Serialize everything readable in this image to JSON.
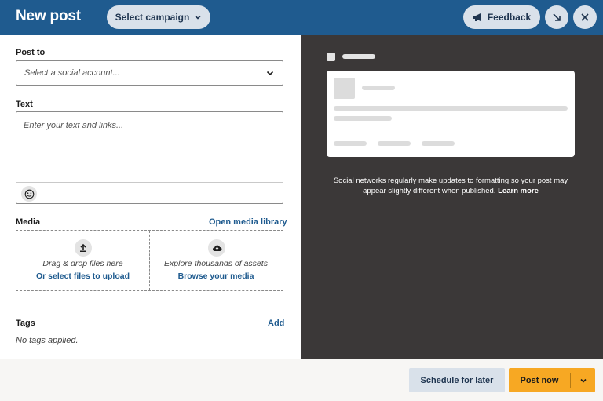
{
  "header": {
    "title": "New post",
    "campaign_label": "Select campaign",
    "feedback_label": "Feedback"
  },
  "post_to": {
    "label": "Post to",
    "placeholder": "Select a social account..."
  },
  "text": {
    "label": "Text",
    "placeholder": "Enter your text and links..."
  },
  "media": {
    "label": "Media",
    "library_link": "Open media library",
    "upload_text": "Drag & drop files here",
    "upload_link": "Or select files to upload",
    "explore_text": "Explore thousands of assets",
    "explore_link": "Browse your media"
  },
  "tags": {
    "label": "Tags",
    "add_link": "Add",
    "empty_text": "No tags applied."
  },
  "preview": {
    "note": "Social networks regularly make updates to formatting so your post may appear slightly different when published.",
    "learn_more": "Learn more"
  },
  "footer": {
    "schedule_label": "Schedule for later",
    "post_label": "Post now"
  },
  "colors": {
    "header_bg": "#1f5b8f",
    "preview_bg": "#3b3838",
    "primary_action": "#f7a823",
    "link": "#1f5b8f"
  },
  "icons": [
    "chevron-down-icon",
    "megaphone-icon",
    "minimize-arrow-icon",
    "close-icon",
    "emoji-icon",
    "upload-icon",
    "cloud-upload-icon"
  ]
}
